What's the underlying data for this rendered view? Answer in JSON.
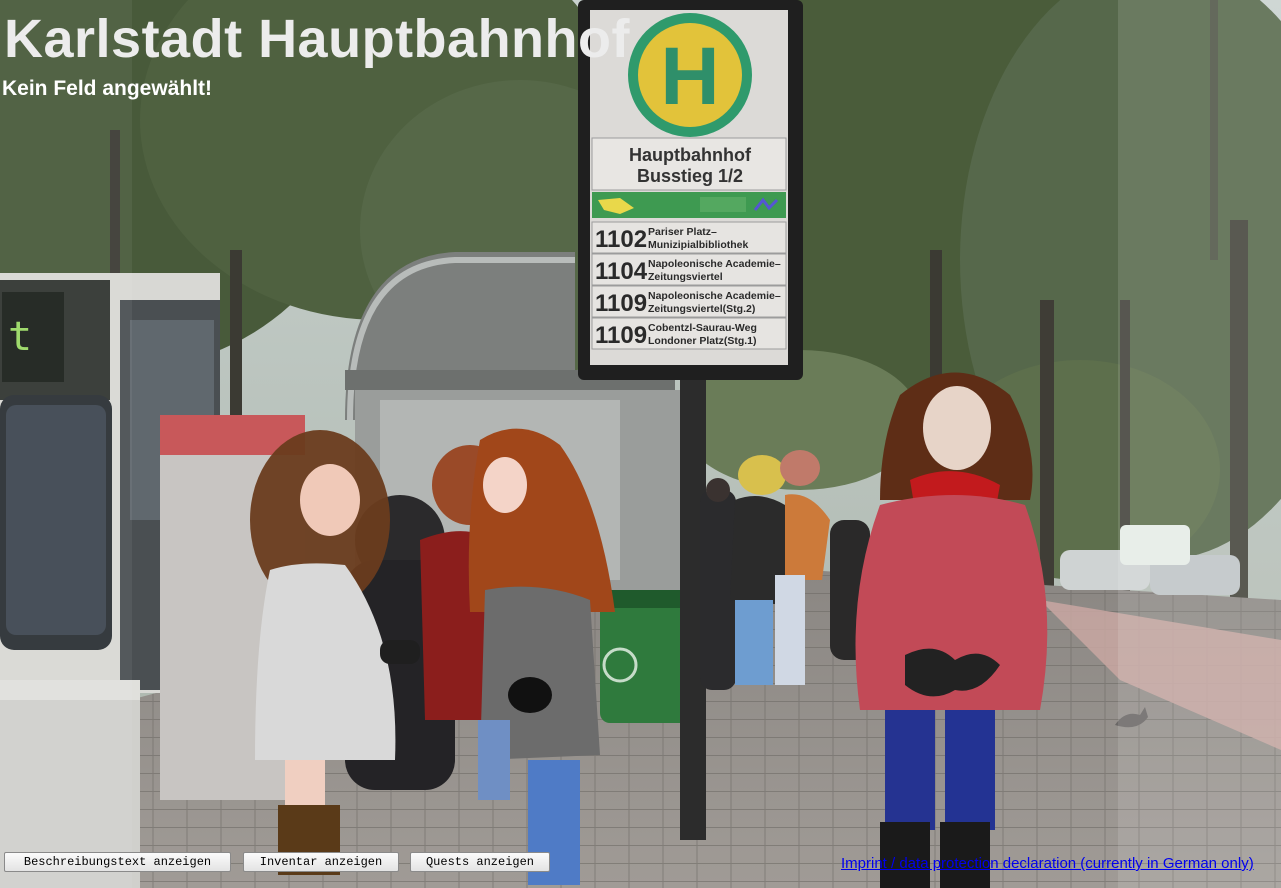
{
  "location_title": "Karlstadt Hauptbahnhof",
  "selection_status": "Kein Feld angewählt!",
  "bus_stop_sign": {
    "logo_letter": "H",
    "stop_name_line1": "Hauptbahnhof",
    "stop_name_line2": "Busstieg 1/2",
    "bus_display_text": "t",
    "routes": [
      {
        "number": "1102",
        "line1": "Pariser Platz–",
        "line2": "Munizipialbibliothek"
      },
      {
        "number": "1104",
        "line1": "Napoleonische Academie–",
        "line2": "Zeitungsviertel"
      },
      {
        "number": "1109",
        "line1": "Napoleonische Academie–",
        "line2": "Zeitungsviertel(Stg.2)"
      },
      {
        "number": "1109",
        "line1": "Cobentzl-Saurau-Weg",
        "line2": "Londoner Platz(Stg.1)"
      }
    ]
  },
  "buttons": {
    "description": "Beschreibungstext anzeigen",
    "inventory": "Inventar anzeigen",
    "quests": "Quests anzeigen"
  },
  "footer": {
    "imprint_link": "Imprint / data protection declaration (currently in German only)"
  }
}
